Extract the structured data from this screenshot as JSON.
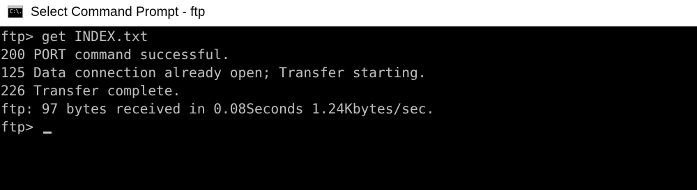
{
  "window": {
    "title": "Select Command Prompt - ftp",
    "icon": "console-app-icon",
    "icon_glyph": "C:\\."
  },
  "console": {
    "lines": [
      "ftp> get INDEX.txt",
      "200 PORT command successful.",
      "125 Data connection already open; Transfer starting.",
      "226 Transfer complete.",
      "ftp: 97 bytes received in 0.08Seconds 1.24Kbytes/sec."
    ],
    "prompt": "ftp> "
  },
  "colors": {
    "background": "#000000",
    "text": "#c0c0c0",
    "titlebar": "#ffffff"
  }
}
